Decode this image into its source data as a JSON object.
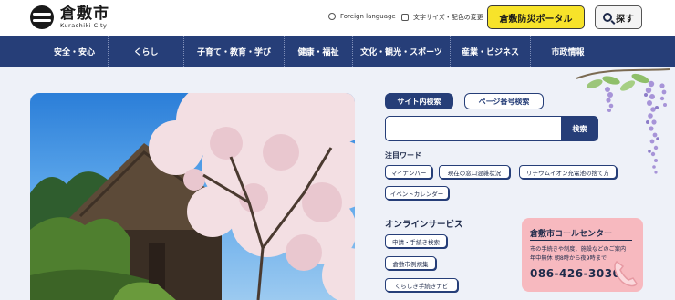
{
  "header": {
    "logo_ja": "倉敷市",
    "logo_en": "Kurashiki City",
    "foreign_language": "Foreign language",
    "text_size_color": "文字サイズ・配色の変更",
    "disaster_portal": "倉敷防災ポータル",
    "search_label": "探す"
  },
  "nav": {
    "items": [
      {
        "label": "安全・安心"
      },
      {
        "label": "くらし"
      },
      {
        "label": "子育て・教育・学び"
      },
      {
        "label": "健康・福祉"
      },
      {
        "label": "文化・観光・スポーツ"
      },
      {
        "label": "産業・ビジネス"
      },
      {
        "label": "市政情報"
      }
    ]
  },
  "search": {
    "tab_site": "サイト内検索",
    "tab_page": "ページ番号検索",
    "input_value": "",
    "submit_label": "検索"
  },
  "keywords": {
    "title": "注目ワード",
    "items": [
      "マイナンバー",
      "現在の窓口混雑状況",
      "リチウムイオン充電池の捨て方",
      "イベントカレンダー"
    ]
  },
  "online": {
    "title": "オンラインサービス",
    "items": [
      "申請・手続き検索",
      "倉敷市例規集",
      "くらしき手続きナビ"
    ]
  },
  "call_center": {
    "title": "倉敷市コールセンター",
    "desc_line1": "市の手続きや制度、施設などのご案内",
    "desc_line2": "年中無休 朝8時から夜9時まで",
    "phone": "086-426-3030"
  },
  "colors": {
    "navy": "#263e78",
    "yellow": "#f7e32a",
    "pink": "#f7b9bf",
    "background": "#eef1f8"
  }
}
